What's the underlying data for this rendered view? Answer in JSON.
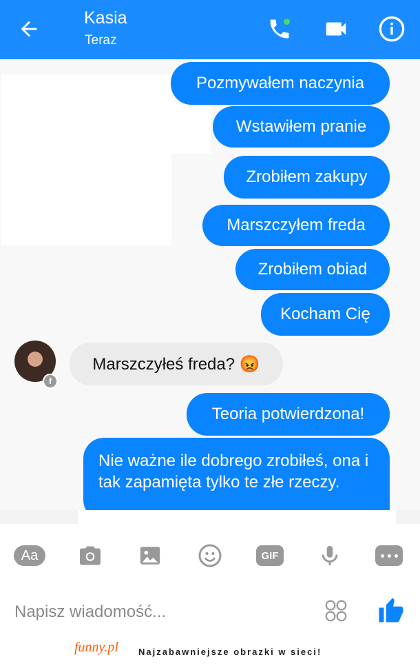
{
  "header": {
    "title": "Kasia",
    "status": "Teraz"
  },
  "messages": [
    {
      "text": "Pozmywałem naczynia",
      "dir": "out"
    },
    {
      "text": "Wstawiłem pranie",
      "dir": "out"
    },
    {
      "text": "Zrobiłem zakupy",
      "dir": "out"
    },
    {
      "text": "Marszczyłem freda",
      "dir": "out"
    },
    {
      "text": "Zrobiłem obiad",
      "dir": "out"
    },
    {
      "text": "Kocham Cię",
      "dir": "out"
    },
    {
      "text": "Marszczyłeś freda? 😡",
      "dir": "in"
    },
    {
      "text": "Teoria potwierdzona!",
      "dir": "out"
    },
    {
      "text": "Nie ważne ile dobrego zrobiłeś, ona i tak zapamięta tylko te złe rzeczy.",
      "dir": "out"
    }
  ],
  "toolbar": {
    "aa": "Aa",
    "gif": "GIF"
  },
  "composer": {
    "placeholder": "Napisz wiadomość..."
  },
  "footer": {
    "brand": "funny.pl",
    "slogan": "Najzabawniejsze obrazki w sieci!"
  },
  "colors": {
    "accent": "#1a8cff",
    "bubble": "#0a84ff",
    "incoming": "#ebebeb"
  }
}
